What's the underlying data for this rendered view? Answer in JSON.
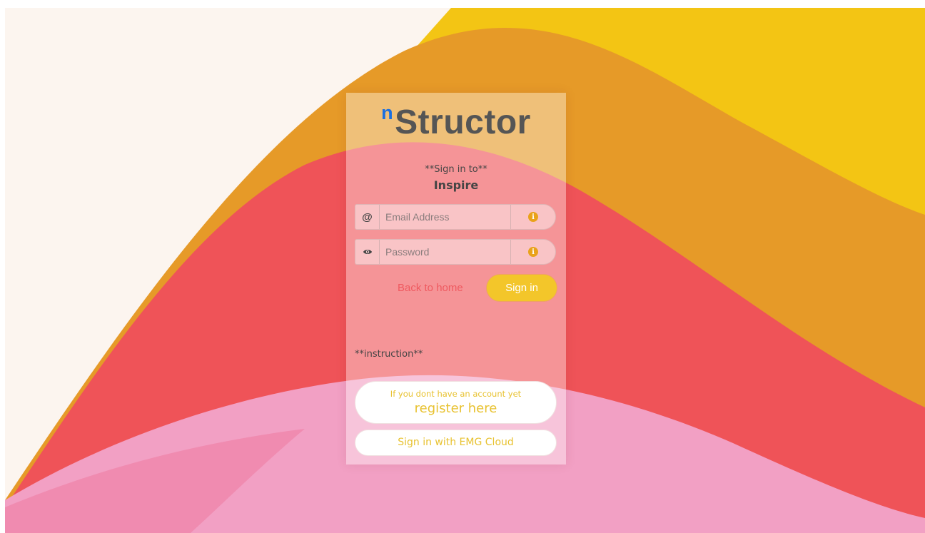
{
  "brand": {
    "logo_prefix": "n",
    "logo_main": "Structor"
  },
  "signin": {
    "heading": "**Sign in to**",
    "app_name": "Inspire"
  },
  "form": {
    "email": {
      "prefix_icon": "at-icon",
      "prefix_glyph": "@",
      "placeholder": "Email Address",
      "value": "",
      "info_icon": "info-icon"
    },
    "password": {
      "prefix_icon": "eye-icon",
      "placeholder": "Password",
      "value": "",
      "info_icon": "info-icon"
    },
    "back_link": "Back to home",
    "submit": "Sign in"
  },
  "instruction": "**instruction**",
  "register": {
    "hint": "If you dont have an account yet",
    "label": "register here"
  },
  "sso": {
    "label": "Sign in with EMG Cloud"
  },
  "colors": {
    "background_cream": "#fcf5ef",
    "wave_yellow": "#f3c514",
    "wave_orange": "#e69a28",
    "wave_red": "#ef5358",
    "wave_pink": "#f2a0c4",
    "accent_yellow": "#f3c62a",
    "link_red": "#ef5a60",
    "logo_blue": "#1a6fe0",
    "logo_gray": "#555555"
  }
}
